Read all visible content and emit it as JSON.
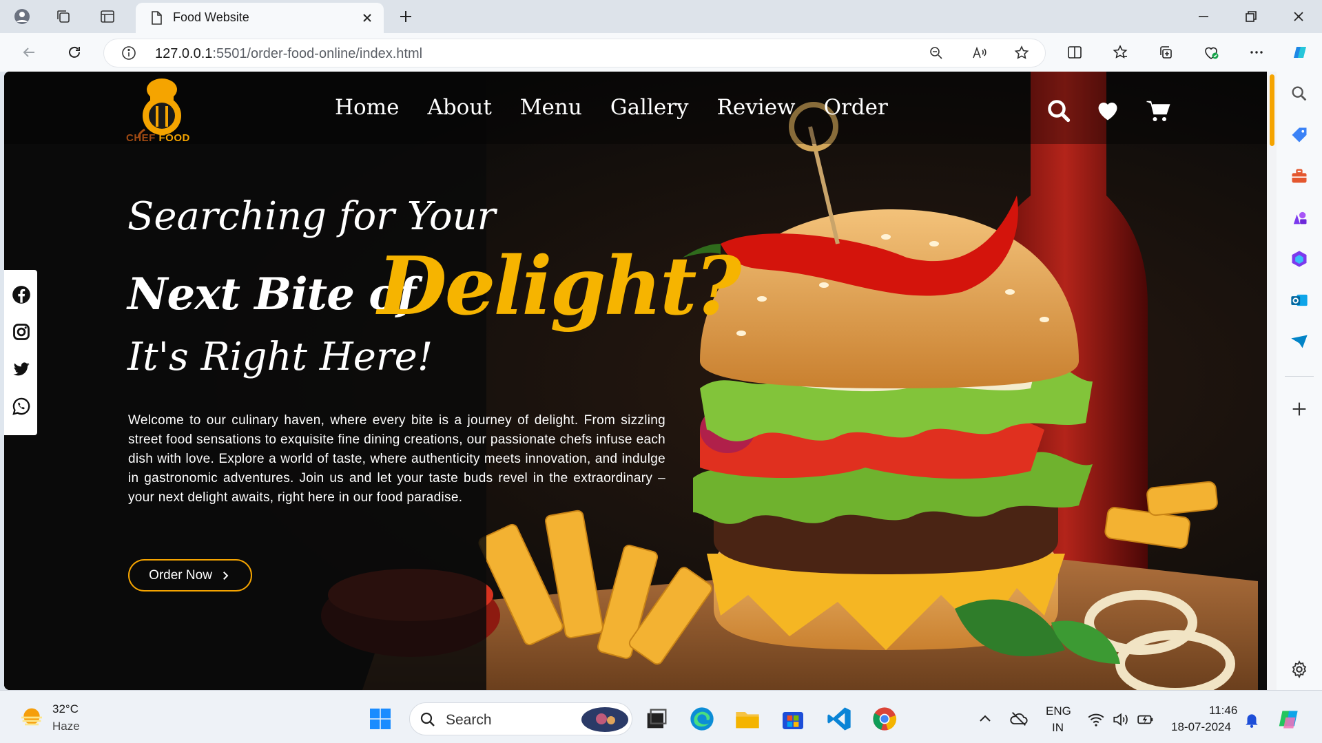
{
  "browser": {
    "tab_title": "Food Website",
    "url_host": "127.0.0.1",
    "url_rest": ":5501/order-food-online/index.html"
  },
  "site": {
    "logo_text_a": "CHEF",
    "logo_text_b": " FOOD",
    "nav": [
      "Home",
      "About",
      "Menu",
      "Gallery",
      "Review",
      "Order"
    ],
    "hero": {
      "line1": "Searching for Your",
      "line2": "Next Bite of",
      "accent": "Delight?",
      "line3": "It's Right Here!",
      "description": "Welcome to our culinary haven, where every bite is a journey of delight. From sizzling street food sensations to exquisite fine dining creations, our passionate chefs infuse each dish with love. Explore a world of taste, where authenticity meets innovation, and indulge in gastronomic adventures. Join us and let your taste buds revel in the extraordinary – your next delight awaits, right here in our food paradise.",
      "cta": "Order Now"
    },
    "colors": {
      "accent": "#f5a400",
      "background": "#0b0b0b"
    }
  },
  "taskbar": {
    "temperature": "32°C",
    "weather": "Haze",
    "search_label": "Search",
    "lang_line1": "ENG",
    "lang_line2": "IN",
    "time": "11:46",
    "date": "18-07-2024"
  }
}
